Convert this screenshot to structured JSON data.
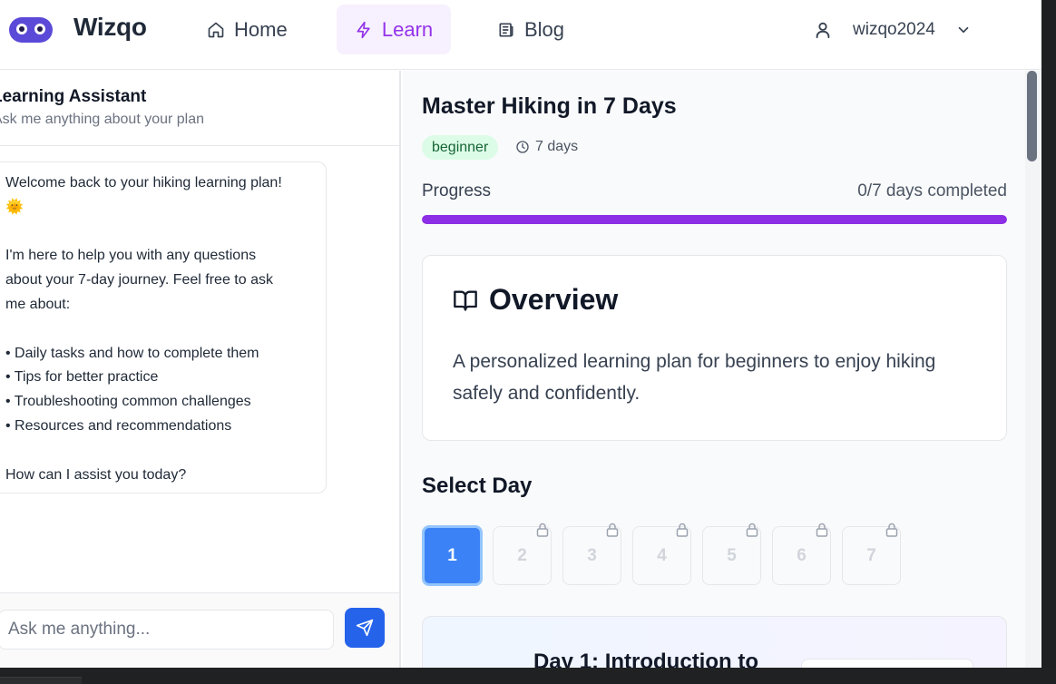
{
  "brand": {
    "name": "Wizqo"
  },
  "nav": {
    "items": [
      {
        "label": "Home",
        "icon": "home-icon"
      },
      {
        "label": "Learn",
        "icon": "lightning-icon",
        "active": true
      },
      {
        "label": "Blog",
        "icon": "newspaper-icon"
      }
    ]
  },
  "user": {
    "name": "wizqo2024"
  },
  "chat": {
    "title": "Learning Assistant",
    "subtitle": "Ask me anything about your plan",
    "message": {
      "line1": "Welcome back to your hiking learning plan!",
      "emoji": "🌞",
      "line2": "I'm here to help you with any questions",
      "line3": "about your 7-day journey. Feel free to ask",
      "line4": "me about:",
      "bullets": [
        "• Daily tasks and how to complete them",
        "• Tips for better practice",
        "• Troubleshooting common challenges",
        "• Resources and recommendations"
      ],
      "closing": "How can I assist you today?"
    },
    "input_placeholder": "Ask me anything..."
  },
  "plan": {
    "title": "Master Hiking in 7 Days",
    "level": "beginner",
    "duration": "7 days",
    "progress_label": "Progress",
    "progress_count": "0/7 days completed",
    "progress_fraction": 1.0,
    "overview": {
      "title": "Overview",
      "description": "A personalized learning plan for beginners to enjoy hiking safely and confidently."
    },
    "select_day_label": "Select Day",
    "days": [
      {
        "label": "1",
        "locked": false,
        "active": true
      },
      {
        "label": "2",
        "locked": true
      },
      {
        "label": "3",
        "locked": true
      },
      {
        "label": "4",
        "locked": true
      },
      {
        "label": "5",
        "locked": true
      },
      {
        "label": "6",
        "locked": true
      },
      {
        "label": "7",
        "locked": true
      }
    ],
    "day_card_title": "Day 1: Introduction to"
  },
  "colors": {
    "accent_purple": "#8b2ee6",
    "primary_blue": "#3b82f6",
    "badge_green": "#dcfce7"
  }
}
